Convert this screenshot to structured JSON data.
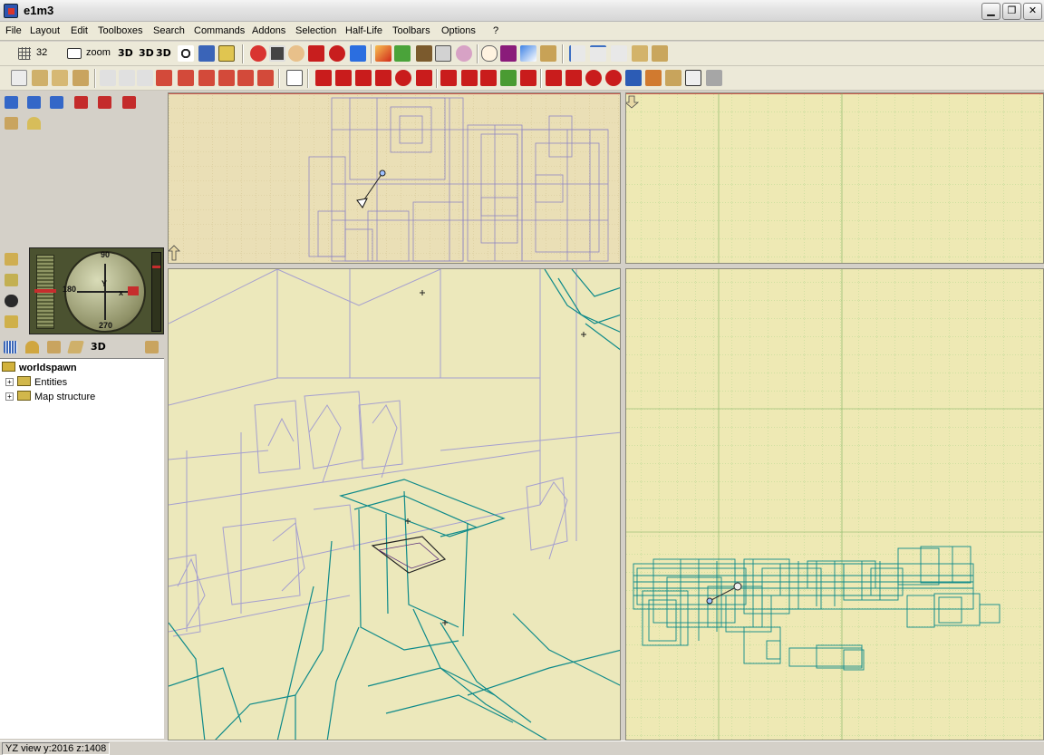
{
  "window": {
    "title": "e1m3"
  },
  "menu": [
    "File",
    "Layout",
    "Edit",
    "Toolboxes",
    "Search",
    "Commands",
    "Addons",
    "Selection",
    "Half-Life",
    "Toolbars",
    "Options",
    "?"
  ],
  "toolbar": {
    "grid_value": "32",
    "zoom_label": "zoom",
    "view_3d_label": "3D"
  },
  "compass": {
    "north": "90",
    "south": "270",
    "west": "180",
    "axis_x": "x",
    "axis_y": "Y"
  },
  "tree": {
    "root": "worldspawn",
    "children": [
      "Entities",
      "Map structure"
    ]
  },
  "status": {
    "text": "YZ view y:2016 z:1408"
  },
  "colors": {
    "view_top_bg": "#eadfb6",
    "view_side_bg": "#eee9b4",
    "view_3d_bg": "#ece8bb",
    "grid_line": "#9bcf7f",
    "brush_purple": "#8f86c3",
    "brush_teal": "#0e8a8a",
    "axis_red": "#c62d2d"
  },
  "icons": [
    "open-icon",
    "grid-icon",
    "zoom-icon",
    "3d-icon",
    "cube-icon",
    "entity-icon",
    "hand-icon",
    "texture-icon",
    "camera-icon"
  ]
}
